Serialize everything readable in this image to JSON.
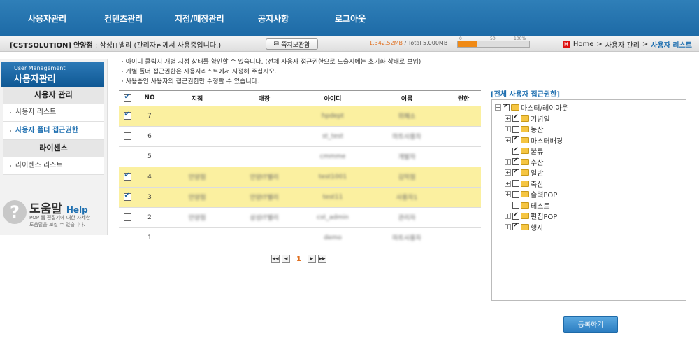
{
  "nav": {
    "items": [
      "사용자관리",
      "컨텐츠관리",
      "지점/매장관리",
      "공지사항",
      "로그아웃"
    ]
  },
  "info": {
    "company": "[CSTSOLUTION]",
    "branch": "안양점",
    "store": " : 삼성IT밸리",
    "note": "(관리자님께서 사용중입니다.)",
    "msg_button": "쪽지보관함",
    "storage_used": "1,342.52MB",
    "storage_total": " / Total 5,000MB",
    "gauge": {
      "fill_pct": 27,
      "ticks": [
        "0",
        "50",
        "100%"
      ]
    }
  },
  "breadcrumb": {
    "home": "Home",
    "sep": ">",
    "parent": "사용자 관리",
    "current": "사용자 리스트"
  },
  "sidebar": {
    "header_en": "User Management",
    "header_ko": "사용자관리",
    "section1": "사용자 관리",
    "items1": [
      {
        "label": "사용자 리스트",
        "active": false
      },
      {
        "label": "사용자 폴더 접근권한",
        "active": true
      }
    ],
    "section2": "라이센스",
    "items2": [
      {
        "label": "라이센스 리스트"
      }
    ],
    "help": {
      "title": "도움말",
      "title_en": "Help",
      "line1": "POP 웹 편집기에 대한 자세한",
      "line2": "도움말을 보실 수 있습니다."
    }
  },
  "notes": [
    "· 아이디 클릭시 개별 지정 상태를 확인할 수 있습니다. (전체 사용자 접근권한으로 노출시에는 초기화 상태로 보임)",
    "· 개별 폴더 접근권한은 사용자리스트에서 지정해 주십시오.",
    "· 사용중인 사용자의 접근권한만 수정할 수 있습니다."
  ],
  "table": {
    "headers": {
      "no": "NO",
      "branch": "지점",
      "store": "매장",
      "id": "아이디",
      "name": "이름",
      "role": "권한"
    },
    "header_checked": true,
    "rows": [
      {
        "checked": true,
        "no": "7",
        "branch": "",
        "store": "",
        "id": "hpdept",
        "name": "위혜소"
      },
      {
        "checked": false,
        "no": "6",
        "branch": "",
        "store": "",
        "id": "st_test",
        "name": "마트사용자"
      },
      {
        "checked": false,
        "no": "5",
        "branch": "",
        "store": "",
        "id": "cmmme",
        "name": "개발자"
      },
      {
        "checked": true,
        "no": "4",
        "branch": "안양점",
        "store": "안양IT밸리",
        "id": "test1001",
        "name": "김막점"
      },
      {
        "checked": true,
        "no": "3",
        "branch": "안양점",
        "store": "안양IT밸리",
        "id": "test11",
        "name": "사용자1"
      },
      {
        "checked": false,
        "no": "2",
        "branch": "안양점",
        "store": "삼성IT밸리",
        "id": "cst_admin",
        "name": "관리자"
      },
      {
        "checked": false,
        "no": "1",
        "branch": "",
        "store": "",
        "id": "demo",
        "name": "마트사용자"
      }
    ]
  },
  "pager": {
    "first": "◀◀",
    "prev": "◀",
    "current": "1",
    "next": "▶",
    "last": "▶▶"
  },
  "tree": {
    "title": "[전체 사용자 접근권한]",
    "root": {
      "label": "마스터/레이아웃",
      "checked": true
    },
    "children": [
      {
        "label": "기념일",
        "checked": true,
        "expandable": true
      },
      {
        "label": "농산",
        "checked": false,
        "expandable": true
      },
      {
        "label": "마스터배경",
        "checked": true,
        "expandable": true
      },
      {
        "label": "물류",
        "checked": true,
        "expandable": false
      },
      {
        "label": "수산",
        "checked": true,
        "expandable": true
      },
      {
        "label": "일반",
        "checked": true,
        "expandable": true
      },
      {
        "label": "축산",
        "checked": false,
        "expandable": true
      },
      {
        "label": "출력POP",
        "checked": false,
        "expandable": true
      },
      {
        "label": "테스트",
        "checked": false,
        "expandable": false
      },
      {
        "label": "편집POP",
        "checked": true,
        "expandable": true
      },
      {
        "label": "행사",
        "checked": true,
        "expandable": true
      }
    ]
  },
  "register_button": "등록하기"
}
